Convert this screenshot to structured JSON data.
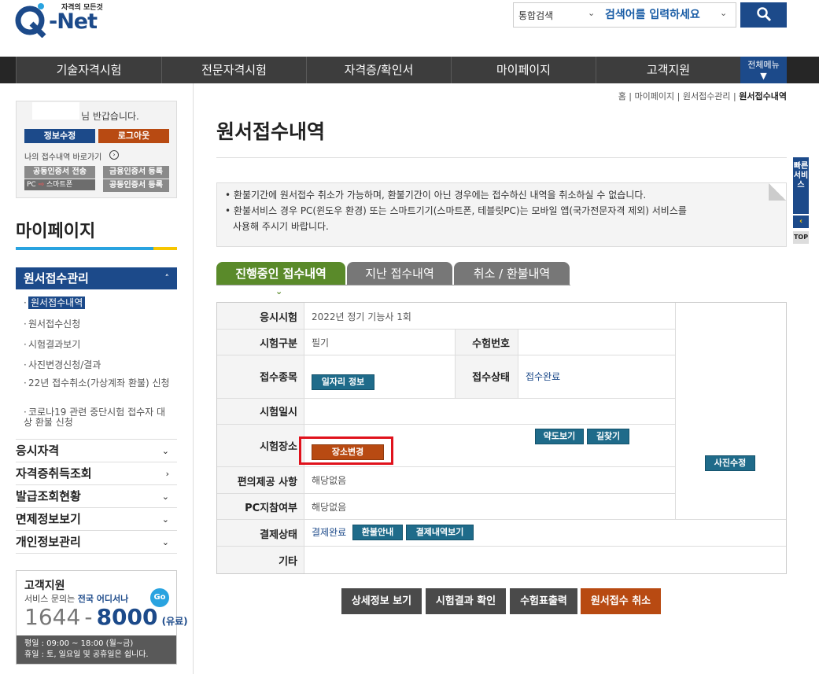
{
  "header": {
    "logo_tagline": "자격의 모든것",
    "logo_text": "Q-Net",
    "search_category": "통합검색",
    "search_placeholder": "검색어를 입력하세요",
    "colors": {
      "brand": "#1c4a8a",
      "accent": "#b84a12",
      "teal": "#1f6b8a",
      "nav": "#3d3d3d"
    }
  },
  "nav": {
    "items": [
      "기술자격시험",
      "전문자격시험",
      "자격증/확인서",
      "마이페이지",
      "고객지원"
    ],
    "all_menu": "전체메뉴"
  },
  "userbox": {
    "greeting": "님 반갑습니다.",
    "edit_label": "정보수정",
    "logout_label": "로그아웃",
    "shortcut_label": "나의 접수내역 바로가기",
    "cert_send": "공동인증서 전송",
    "cert_pc": "PC",
    "cert_phone": "스마트폰",
    "fin_cert_1": "금융인증서 등록",
    "fin_cert_2": "공동인증서 등록"
  },
  "sidebar": {
    "title": "마이페이지",
    "active_menu": "원서접수관리",
    "sub_items": [
      "원서접수내역",
      "원서접수신청",
      "시험결과보기",
      "사진변경신청/결과",
      "22년 접수취소(가상계좌 환불) 신청",
      "코로나19 관련 중단시험 접수자 대상 환불 신청"
    ],
    "categories": [
      "응시자격",
      "자격증취득조회",
      "발급조회현황",
      "면제정보보기",
      "개인정보관리"
    ]
  },
  "support": {
    "title": "고객지원",
    "desc_prefix": "서비스 문의는 ",
    "desc_highlight": "전국 어디서나",
    "go": "Go",
    "phone_a": "1644",
    "phone_dash": "-",
    "phone_b": "8000",
    "phone_fee": "(유료)",
    "hours": "평일 : 09:00 ~ 18:00 (월~금)",
    "holiday": "휴일 : 토, 일요일 및 공휴일은 쉽니다."
  },
  "breadcrumb": [
    "홈",
    "마이페이지",
    "원서접수관리",
    "원서접수내역"
  ],
  "page_title": "원서접수내역",
  "notice": [
    "환불기간에 원서접수 취소가 가능하며, 환불기간이 아닌 경우에는 접수하신 내역을 취소하실 수 없습니다.",
    "환불서비스 경우 PC(윈도우 환경) 또는 스마트기기(스마트폰, 테블릿PC)는 모바일 앱(국가전문자격 제외) 서비스를",
    "사용해 주시기 바랍니다."
  ],
  "tabs": [
    "진행중인 접수내역",
    "지난 접수내역",
    "취소 / 환불내역"
  ],
  "table": {
    "labels": {
      "exam": "응시시험",
      "type": "시험구분",
      "exam_no": "수험번호",
      "field": "접수종목",
      "status": "접수상태",
      "datetime": "시험일시",
      "place": "시험장소",
      "convenience": "편의제공 사항",
      "pc": "PC지참여부",
      "payment": "결제상태",
      "etc": "기타"
    },
    "values": {
      "exam": "2022년 정기 기능사 1회",
      "type": "필기",
      "exam_no": "",
      "status": "접수완료",
      "datetime": "",
      "convenience": "해당없음",
      "pc": "해당없음",
      "payment": "결제완료",
      "etc": ""
    },
    "buttons": {
      "job_info": "일자리 정보",
      "map": "약도보기",
      "directions": "길찾기",
      "change_place": "장소변경",
      "photo_edit": "사진수정",
      "refund_info": "환불안내",
      "payment_history": "결제내역보기"
    }
  },
  "actions": [
    "상세정보 보기",
    "시험결과 확인",
    "수험표출력",
    "원서접수 취소"
  ],
  "quick": {
    "label": "빠른서비스",
    "top": "TOP"
  }
}
